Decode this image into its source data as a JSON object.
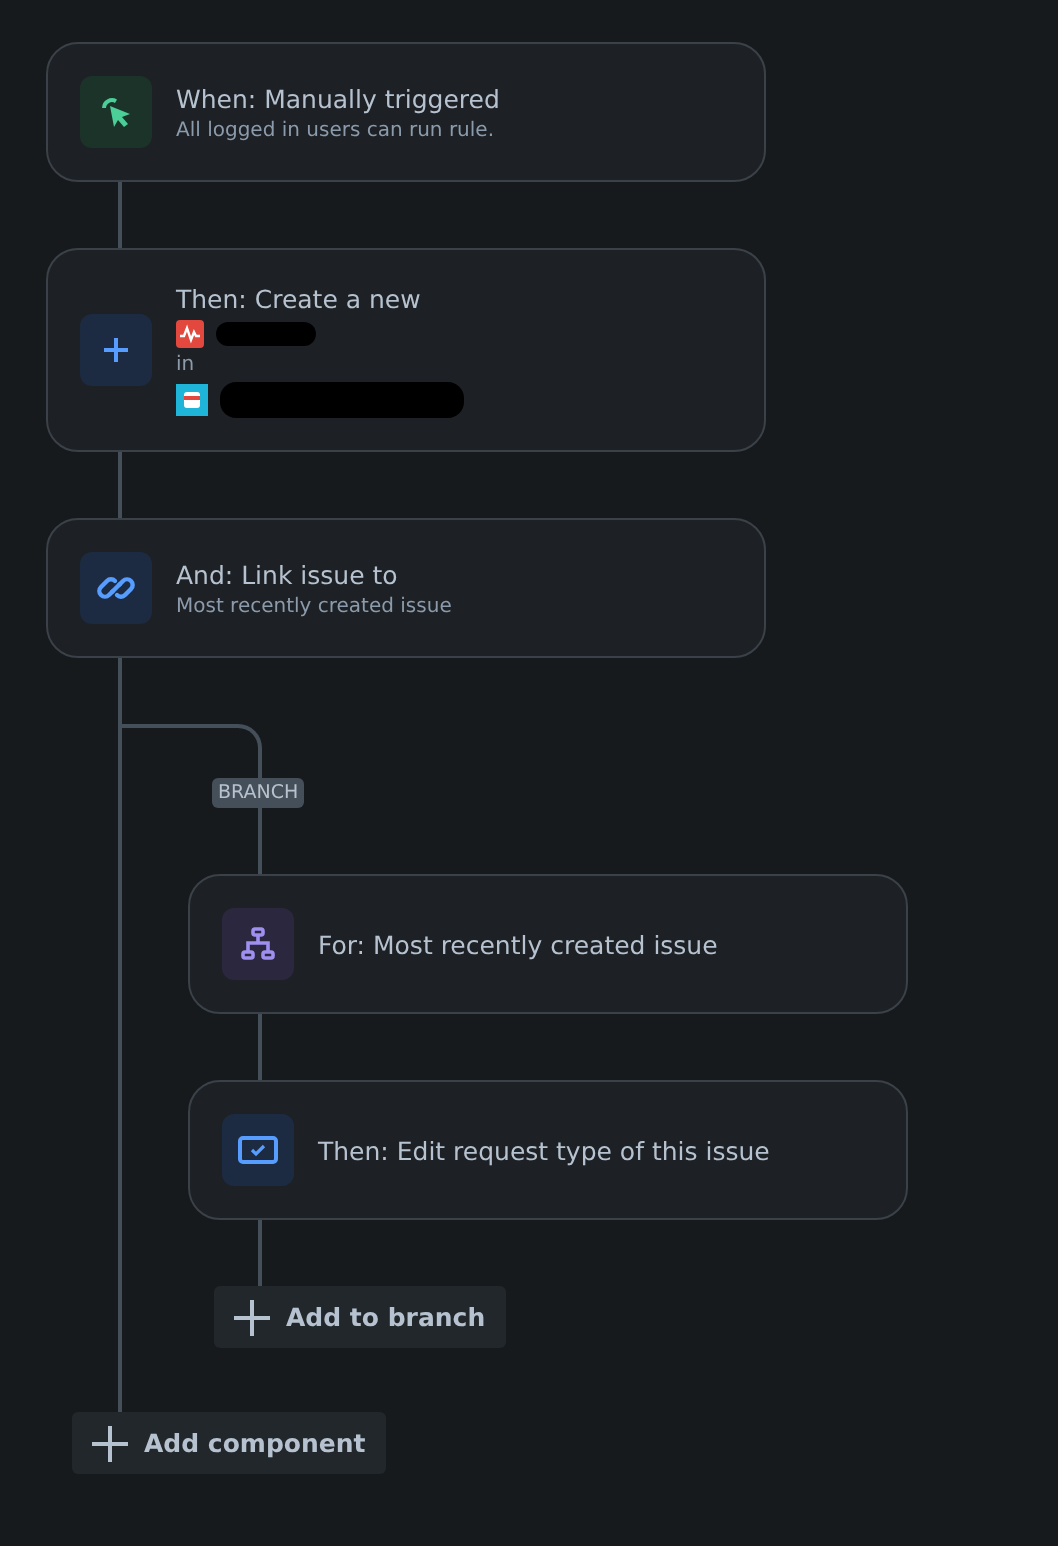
{
  "components": [
    {
      "kind": "trigger",
      "title": "When: Manually triggered",
      "subtitle": "All logged in users can run rule."
    },
    {
      "kind": "create",
      "title": "Then: Create a new",
      "details": [
        {
          "kind": "issue-type-redacted"
        },
        {
          "kind": "text",
          "text": "in"
        },
        {
          "kind": "project-redacted"
        }
      ]
    },
    {
      "kind": "link",
      "title": "And: Link issue to",
      "subtitle": "Most recently created issue"
    }
  ],
  "branch": {
    "badge": "BRANCH",
    "components": [
      {
        "kind": "branch-for",
        "title": "For: Most recently created issue"
      },
      {
        "kind": "edit",
        "title": "Then: Edit request type of this issue"
      }
    ],
    "add_button": "Add to branch"
  },
  "add_component": "Add component"
}
